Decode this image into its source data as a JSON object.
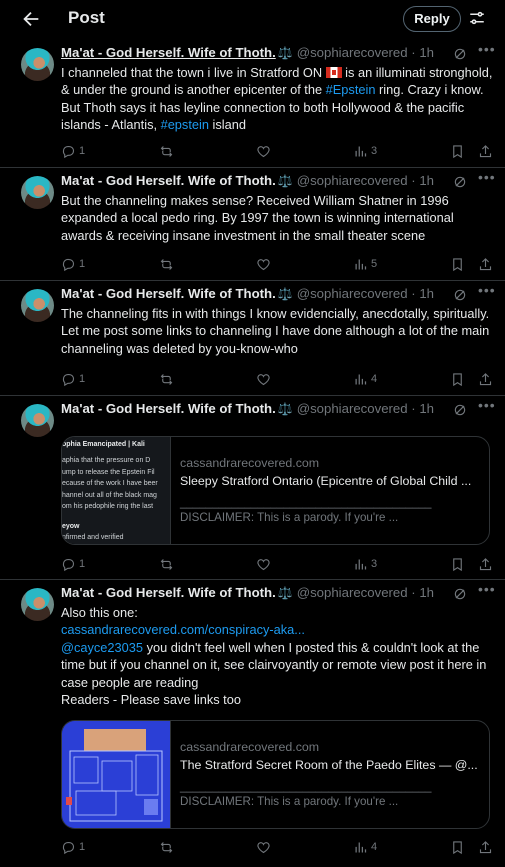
{
  "header": {
    "title": "Post",
    "reply_label": "Reply"
  },
  "author": {
    "name": "Ma'at - God Herself. Wife of Thoth.",
    "badge": "⚖️",
    "handle": "@sophiarecovered",
    "sep": "·"
  },
  "tweets": [
    {
      "time": "1h",
      "text_parts": [
        "I channeled that the town i live in Stratford ON ",
        " is an illuminati stronghold, & under the ground is another epicenter of the ",
        "#Epstein",
        " ring. Crazy i know. But Thoth says it has leyline connection to both Hollywood & the pacific islands  - Atlantis, ",
        "#epstein",
        " island"
      ],
      "replies": "1",
      "reposts": "",
      "likes": "",
      "views": "3"
    },
    {
      "time": "1h",
      "text": "But the channeling makes sense? Received William Shatner in 1996 expanded a local pedo ring. By 1997 the town is winning international awards & receiving insane investment in the small theater scene",
      "replies": "1",
      "reposts": "",
      "likes": "",
      "views": "5"
    },
    {
      "time": "1h",
      "text": "The channeling fits in with things I know evidencially, anecdotally, spiritually.  Let me post some links to channeling I have done although a lot of the main channeling was deleted by you-know-who",
      "replies": "1",
      "reposts": "",
      "likes": "",
      "views": "4"
    },
    {
      "time": "1h",
      "card": {
        "domain": "cassandrarecovered.com",
        "title": "Sleepy Stratford Ontario (Epicentre of Global Child ...",
        "desc": "_______________________________________ DISCLAIMER: This is a parody. If you're ...",
        "thumb_lines": [
          "ophia Emancipated | Kali",
          "aphia that the pressure on D",
          "ump to release the Epstein Fil",
          "ecause of the work I have beer",
          "hannel out all of the black mag",
          "om his pedophile ring the last"
        ],
        "thumb_footer": [
          "eyow",
          "nfirmed and verified"
        ]
      },
      "replies": "1",
      "reposts": "",
      "likes": "",
      "views": "3"
    },
    {
      "time": "1h",
      "lines": [
        "Also this one:"
      ],
      "link": "cassandrarecovered.com/conspiracy-aka...",
      "mention": "@cayce23035",
      "mention_text": " you didn't feel well when I posted this & couldn't look at the time but if you channel on it, see clairvoyantly or remote view post it here in case people are reading",
      "tail": "Readers - Please save links too",
      "card": {
        "domain": "cassandrarecovered.com",
        "title": "The Stratford Secret Room of the Paedo Elites — @...",
        "desc": "_______________________________________ DISCLAIMER: This is a parody. If you're ..."
      },
      "replies": "1",
      "reposts": "",
      "likes": "",
      "views": "4"
    }
  ],
  "colors": {
    "bg": "#000000",
    "text": "#e7e9ea",
    "muted": "#71767b",
    "link": "#1d9bf0",
    "border": "#2f3336"
  },
  "icons": [
    "back-arrow-icon",
    "tune-icon",
    "grok-icon",
    "more-icon",
    "reply-icon",
    "repost-icon",
    "like-icon",
    "views-icon",
    "bookmark-icon",
    "share-icon",
    "canada-flag-icon"
  ]
}
